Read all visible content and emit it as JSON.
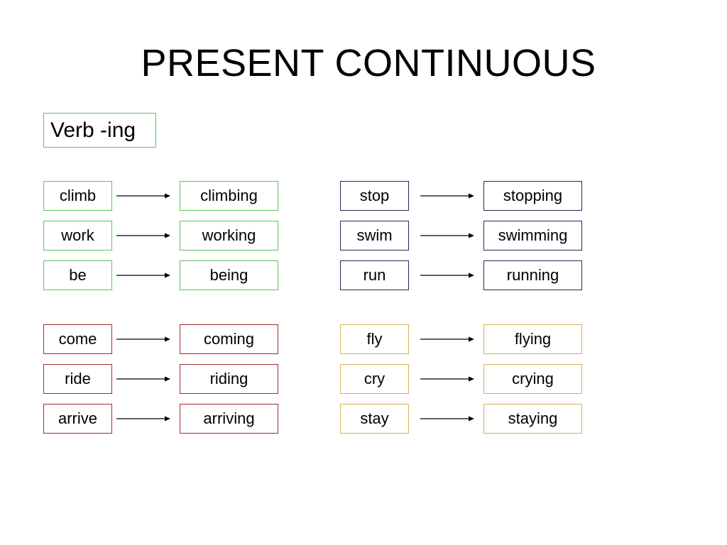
{
  "title": "PRESENT CONTINUOUS",
  "label": "Verb -ing",
  "groups": [
    {
      "color": "#5cc35c",
      "pairs": [
        {
          "base": "climb",
          "ing": "climbing"
        },
        {
          "base": "work",
          "ing": "working"
        },
        {
          "base": "be",
          "ing": "being"
        }
      ]
    },
    {
      "color": "#1f2a55",
      "pairs": [
        {
          "base": "stop",
          "ing": "stopping"
        },
        {
          "base": "swim",
          "ing": "swimming"
        },
        {
          "base": "run",
          "ing": "running"
        }
      ]
    },
    {
      "color": "#a52a2a",
      "pairs": [
        {
          "base": "come",
          "ing": "coming"
        },
        {
          "base": "ride",
          "ing": "riding"
        },
        {
          "base": "arrive",
          "ing": "arriving"
        }
      ]
    },
    {
      "color": "#d9b15a",
      "pairs": [
        {
          "base": "fly",
          "ing": "flying"
        },
        {
          "base": "cry",
          "ing": "crying"
        },
        {
          "base": "stay",
          "ing": "staying"
        }
      ]
    }
  ]
}
